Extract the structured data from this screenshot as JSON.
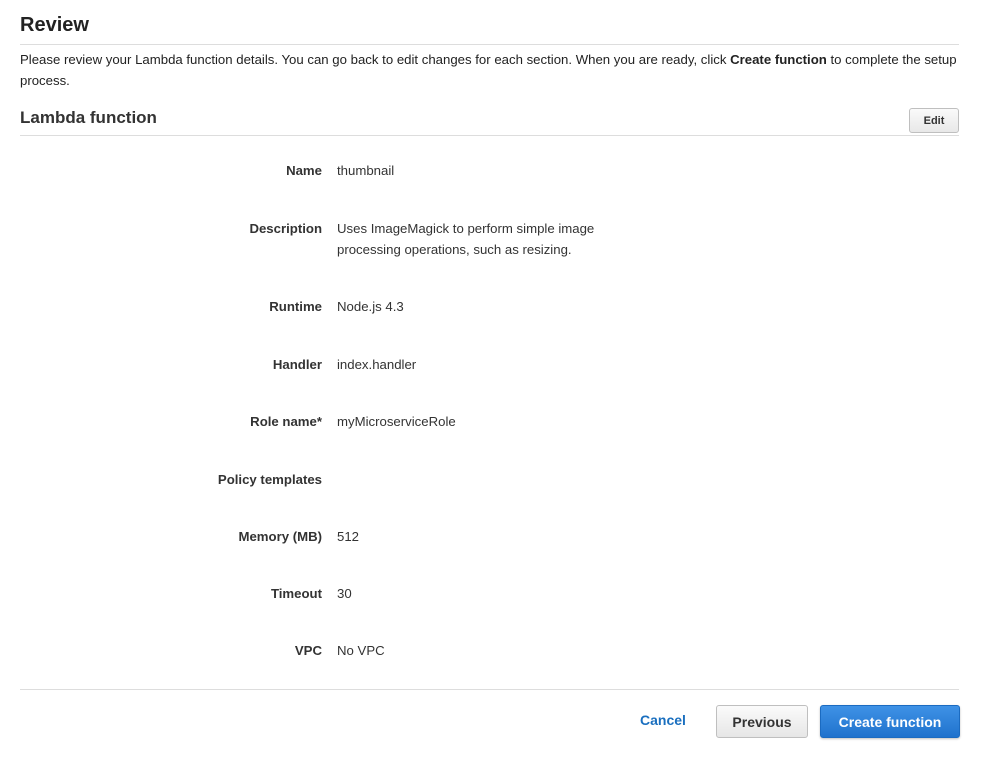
{
  "page": {
    "title": "Review",
    "intro_prefix": "Please review your Lambda function details. You can go back to edit changes for each section. When you are ready, click ",
    "intro_bold": "Create function",
    "intro_suffix": " to complete the setup process."
  },
  "section": {
    "title": "Lambda function",
    "edit_label": "Edit"
  },
  "details": [
    {
      "label": "Name",
      "value": "thumbnail"
    },
    {
      "label": "Description",
      "value": "Uses ImageMagick to perform simple image processing operations, such as resizing."
    },
    {
      "label": "Runtime",
      "value": "Node.js 4.3"
    },
    {
      "label": "Handler",
      "value": "index.handler"
    },
    {
      "label": "Role name*",
      "value": "myMicroserviceRole"
    },
    {
      "label": "Policy templates",
      "value": ""
    },
    {
      "label": "Memory (MB)",
      "value": "512"
    },
    {
      "label": "Timeout",
      "value": "30"
    },
    {
      "label": "VPC",
      "value": "No VPC"
    }
  ],
  "footer": {
    "cancel_label": "Cancel",
    "previous_label": "Previous",
    "create_label": "Create function"
  },
  "colors": {
    "primary": "#2a7fdb",
    "link": "#1a6fbf"
  }
}
